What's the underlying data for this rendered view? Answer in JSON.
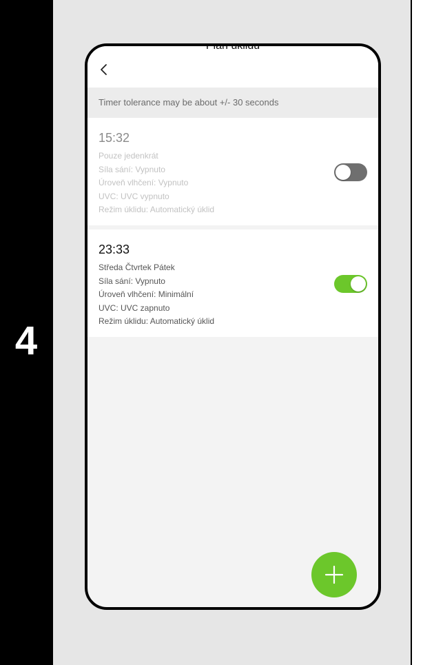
{
  "step": {
    "number": "4"
  },
  "header": {
    "title": "Plán úklidu"
  },
  "notice": "Timer tolerance may be about +/- 30 seconds",
  "schedules": [
    {
      "time": "15:32",
      "repeat": "Pouze jedenkrát",
      "suction": "Síla sání: Vypnuto",
      "humidity": "Úroveň vlhčení: Vypnuto",
      "uvc": "UVC: UVC vypnuto",
      "mode": "Režim úklidu: Automatický úklid",
      "enabled": false
    },
    {
      "time": "23:33",
      "repeat": "Středa Čtvrtek Pátek",
      "suction": "Síla sání: Vypnuto",
      "humidity": "Úroveň vlhčení: Minimální",
      "uvc": "UVC: UVC zapnuto",
      "mode": "Režim úklidu: Automatický úklid",
      "enabled": true
    }
  ],
  "colors": {
    "accent": "#6cc72b",
    "toggle_off": "#6f6f6f"
  },
  "icons": {
    "back": "chevron-left-icon",
    "add": "plus-icon"
  }
}
